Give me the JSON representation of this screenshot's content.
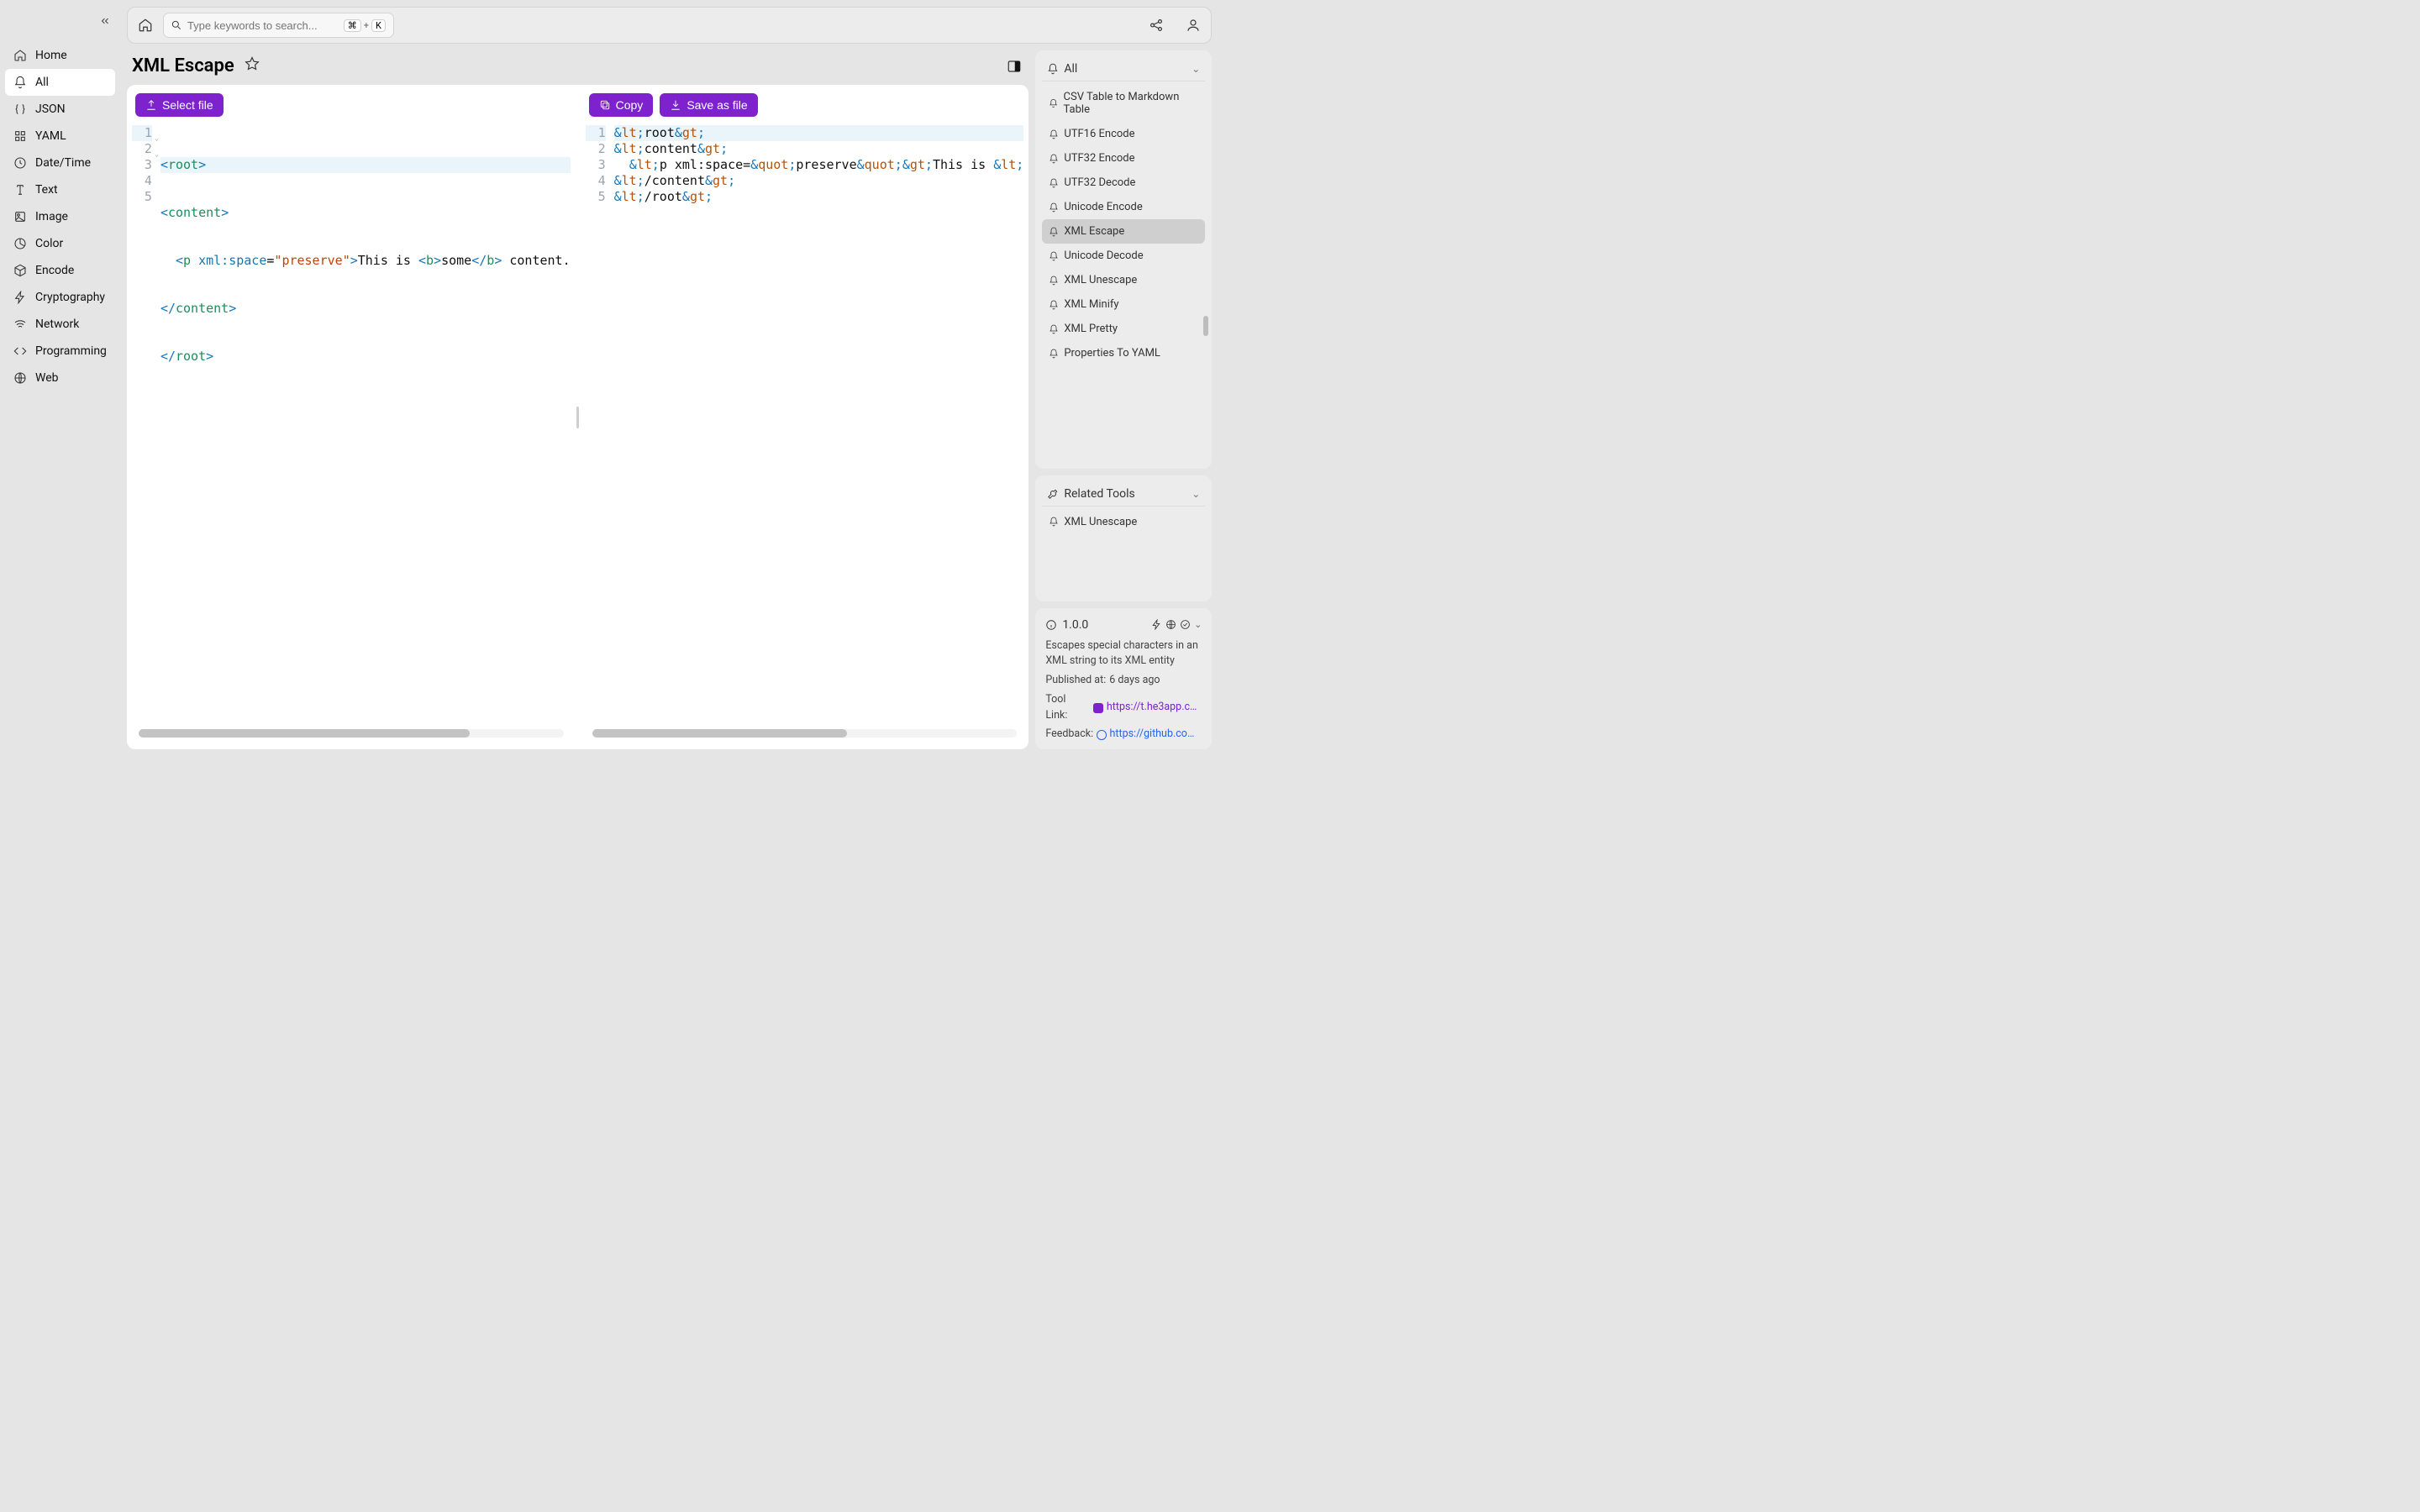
{
  "sidebar": {
    "items": [
      {
        "label": "Home",
        "icon": "home-icon"
      },
      {
        "label": "All",
        "icon": "bell-icon",
        "active": true
      },
      {
        "label": "JSON",
        "icon": "braces-icon"
      },
      {
        "label": "YAML",
        "icon": "grid-icon"
      },
      {
        "label": "Date/Time",
        "icon": "clock-icon"
      },
      {
        "label": "Text",
        "icon": "text-icon"
      },
      {
        "label": "Image",
        "icon": "image-icon"
      },
      {
        "label": "Color",
        "icon": "pie-icon"
      },
      {
        "label": "Encode",
        "icon": "box-icon"
      },
      {
        "label": "Cryptography",
        "icon": "bolt-icon"
      },
      {
        "label": "Network",
        "icon": "wifi-icon"
      },
      {
        "label": "Programming",
        "icon": "code-icon"
      },
      {
        "label": "Web",
        "icon": "globe-icon"
      }
    ]
  },
  "topbar": {
    "search_placeholder": "Type keywords to search...",
    "shortcut_cmd": "⌘",
    "shortcut_plus": "+",
    "shortcut_key": "K"
  },
  "page": {
    "title": "XML Escape"
  },
  "buttons": {
    "select_file": "Select file",
    "copy": "Copy",
    "save_as_file": "Save as file"
  },
  "input_code": {
    "lines": [
      "1",
      "2",
      "3",
      "4",
      "5"
    ],
    "l1": {
      "open": "<",
      "tag": "root",
      "close": ">"
    },
    "l2": {
      "open": "<",
      "tag": "content",
      "close": ">"
    },
    "l3": {
      "indent": "  ",
      "open": "<",
      "tag": "p",
      "sp": " ",
      "attr": "xml:space",
      "eq": "=",
      "q1": "\"",
      "val": "preserve",
      "q2": "\"",
      "close": ">",
      "t1": "This is ",
      "bopen": "<",
      "btag": "b",
      "bclose": ">",
      "t2": "some",
      "bopen2": "</",
      "btag2": "b",
      "bclose2": ">",
      "t3": " content."
    },
    "l4": {
      "open": "</",
      "tag": "content",
      "close": ">"
    },
    "l5": {
      "open": "</",
      "tag": "root",
      "close": ">"
    }
  },
  "output_code": {
    "lines": [
      "1",
      "2",
      "3",
      "4",
      "5"
    ],
    "l1": "&lt;root&gt;",
    "l2": "&lt;content&gt;",
    "l3": "  &lt;p xml:space=&quot;preserve&quot;&gt;This is &lt;",
    "l4": "&lt;/content&gt;",
    "l5": "&lt;/root&gt;"
  },
  "right": {
    "all_label": "All",
    "tools": [
      "CSV Table to Markdown Table",
      "UTF16 Encode",
      "UTF32 Encode",
      "UTF32 Decode",
      "Unicode Encode",
      "XML Escape",
      "Unicode Decode",
      "XML Unescape",
      "XML Minify",
      "XML Pretty",
      "Properties To YAML"
    ],
    "tools_active_index": 5,
    "related_label": "Related Tools",
    "related": [
      "XML Unescape"
    ]
  },
  "version_card": {
    "version": "1.0.0",
    "description": "Escapes special characters in an XML string to its XML entity",
    "published_label": "Published at:",
    "published_value": "6 days ago",
    "tool_link_label": "Tool Link:",
    "tool_link": "https://t.he3app.co…",
    "feedback_label": "Feedback:",
    "feedback": "https://github.com/…"
  }
}
